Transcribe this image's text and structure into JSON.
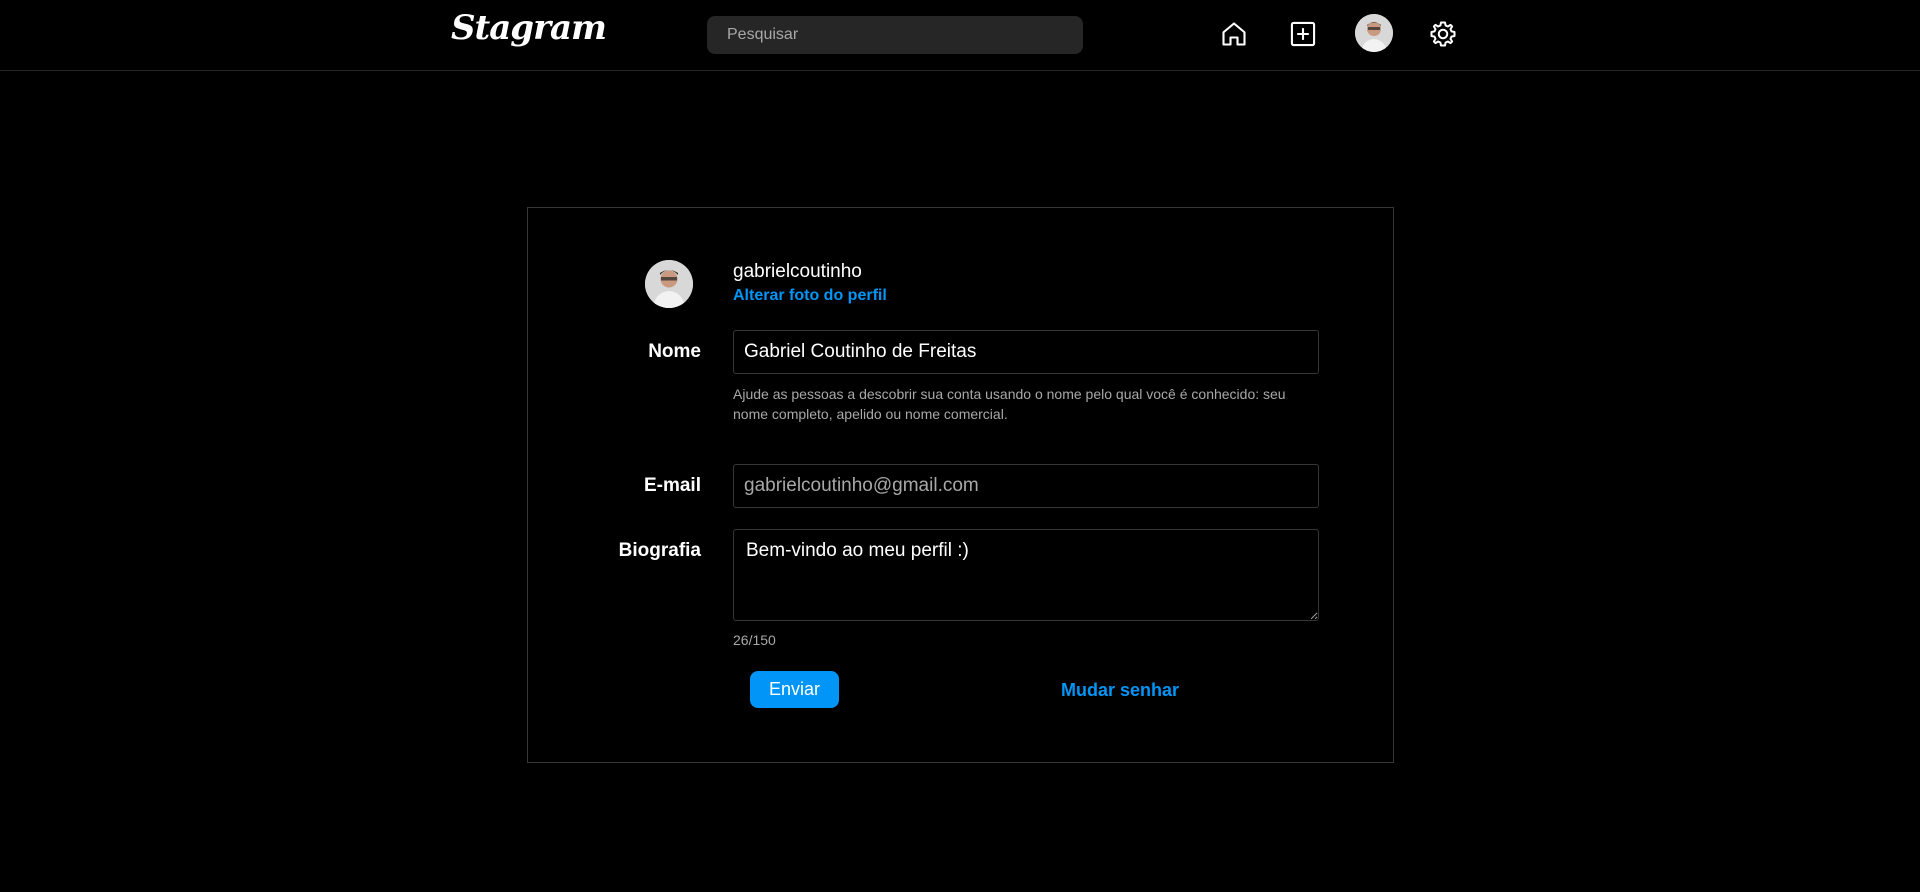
{
  "app": {
    "logo_text": "Stagram"
  },
  "header": {
    "search": {
      "placeholder": "Pesquisar",
      "value": ""
    },
    "icons": [
      "home-icon",
      "add-post-icon",
      "profile-avatar",
      "gear-icon"
    ]
  },
  "profile": {
    "username": "gabrielcoutinho",
    "change_photo_label": "Alterar foto do perfil"
  },
  "form": {
    "name": {
      "label": "Nome",
      "value": "Gabriel Coutinho de Freitas",
      "help": "Ajude as pessoas a descobrir sua conta usando o nome pelo qual você é conhecido: seu nome completo, apelido ou nome comercial."
    },
    "email": {
      "label": "E-mail",
      "value": "gabrielcoutinho@gmail.com"
    },
    "bio": {
      "label": "Biografia",
      "value": "Bem-vindo ao meu perfil :)",
      "counter": "26/150"
    },
    "submit_label": "Enviar",
    "change_password_label": "Mudar senhar"
  },
  "colors": {
    "background": "#000000",
    "accent": "#0095f6",
    "border": "#363636",
    "muted_text": "#a8a8a8",
    "input_bg": "#262626"
  }
}
